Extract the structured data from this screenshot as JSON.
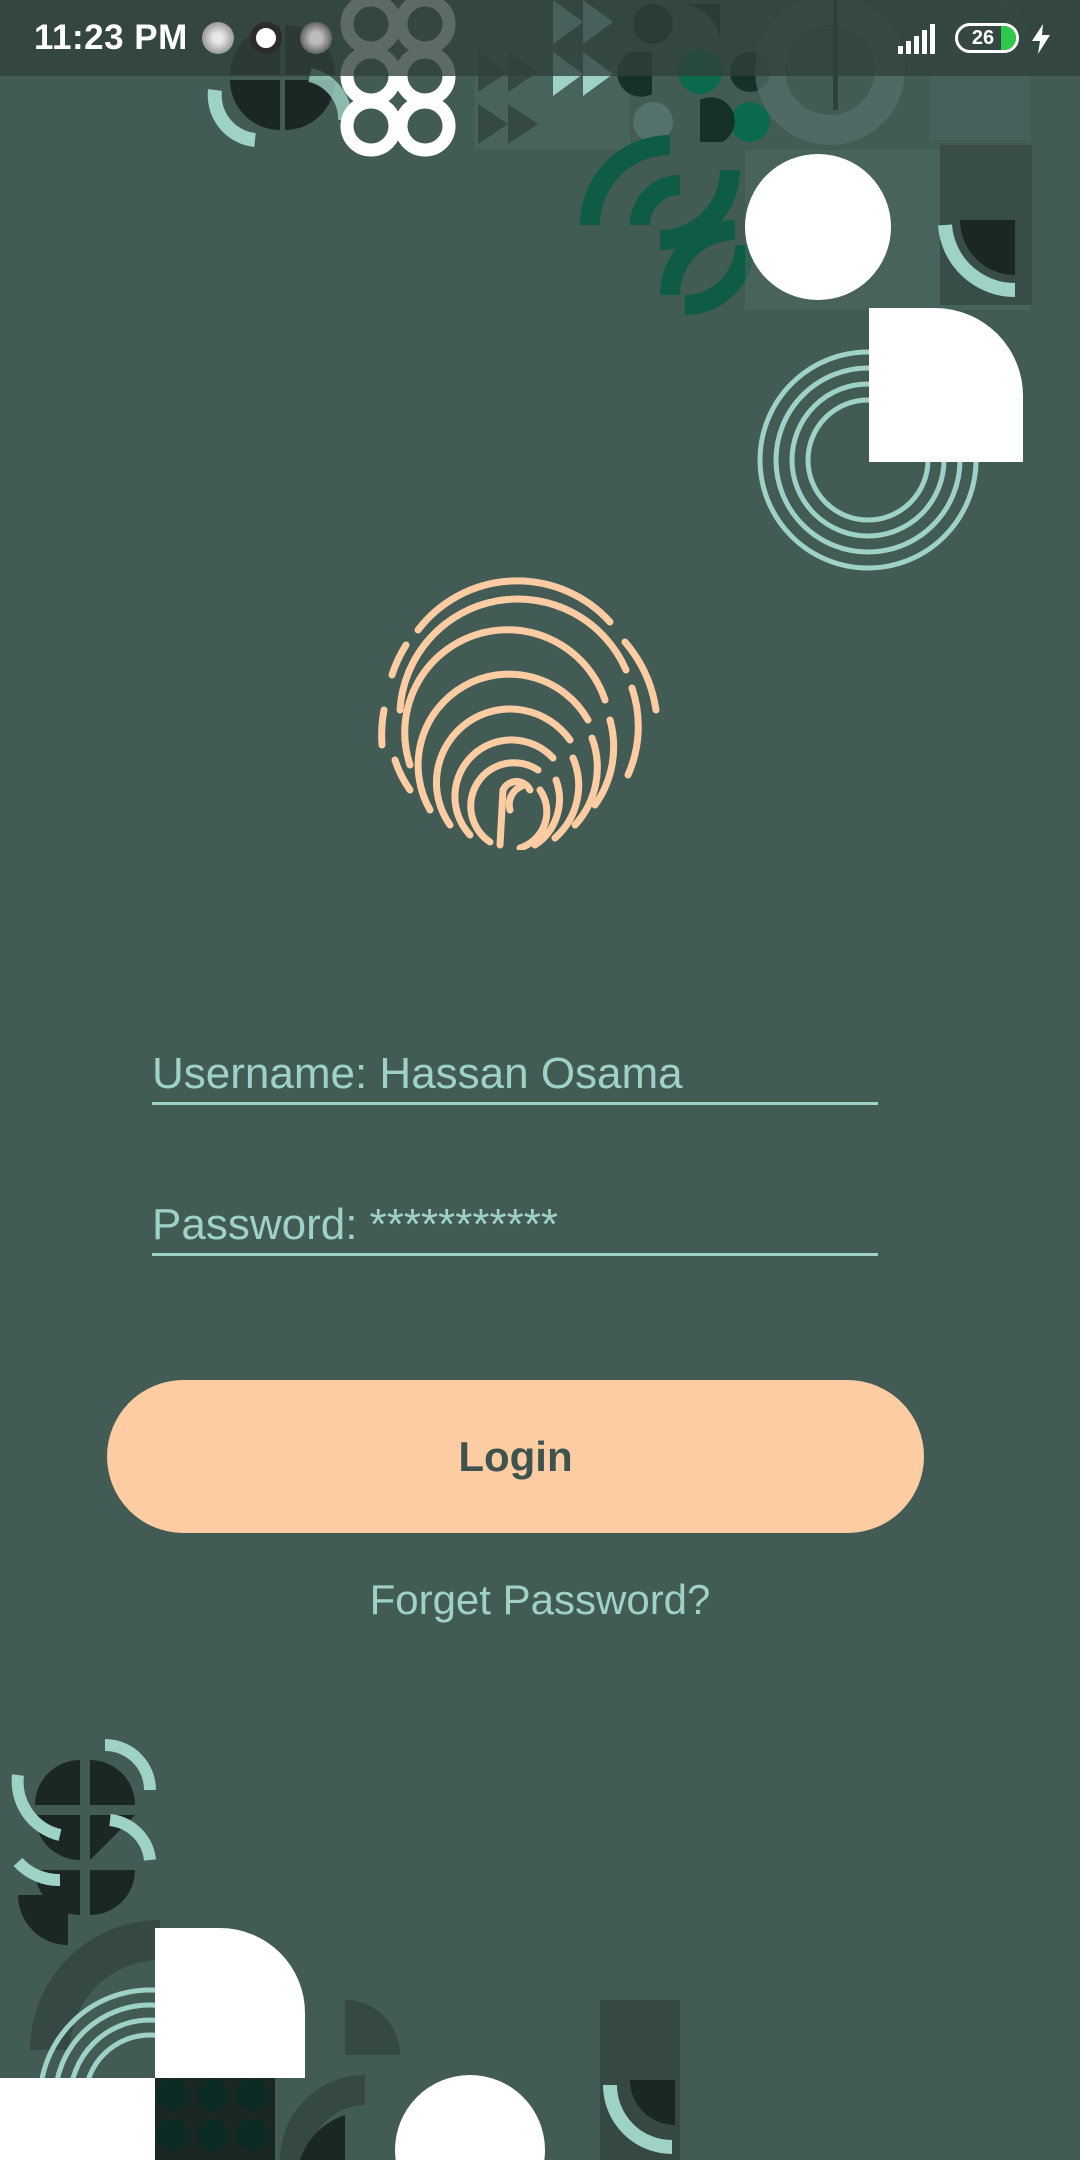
{
  "status_bar": {
    "time": "11:23 PM",
    "battery_level": "26",
    "battery_fraction": 0.26,
    "icons": [
      "notification-icon",
      "media-icon",
      "notification-icon",
      "signal-icon",
      "battery-icon",
      "charging-icon"
    ]
  },
  "login": {
    "username_field": "Username: Hassan Osama",
    "password_field": "Password: ***********",
    "login_button": "Login",
    "forgot_link": "Forget Password?",
    "fingerprint_icon": "fingerprint-icon"
  },
  "colors": {
    "background": "#425b55",
    "accent": "#fdcca2",
    "field_text": "#9fd2c6",
    "button_text": "#3d534d"
  }
}
